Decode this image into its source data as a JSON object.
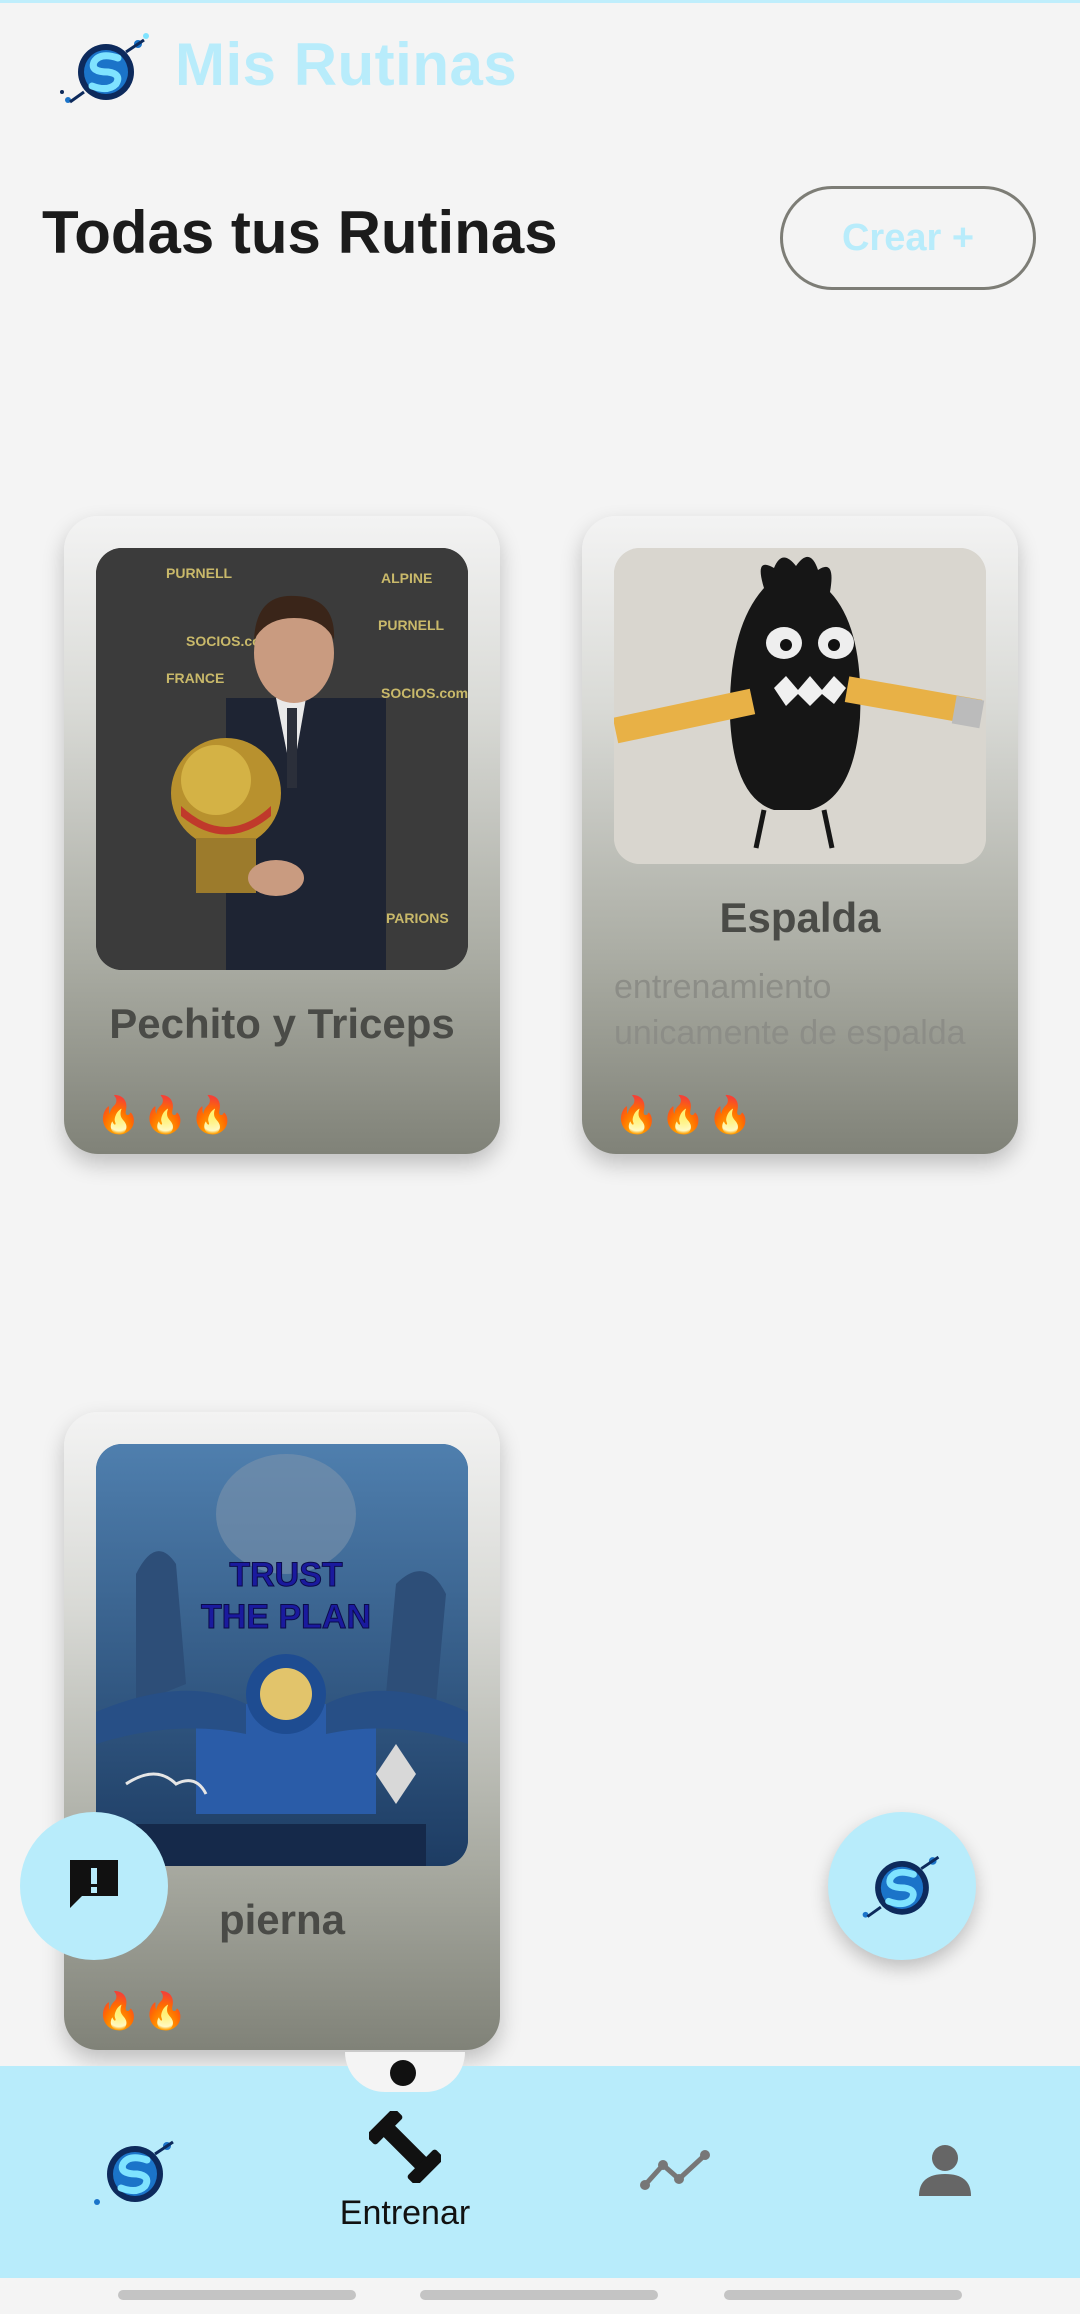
{
  "header": {
    "app_title": "Mis Rutinas",
    "logo_icon": "app-logo-icon"
  },
  "main": {
    "page_title": "Todas tus Rutinas",
    "create_label": "Crear +"
  },
  "routines": [
    {
      "title": "Pechito y Triceps",
      "description": "",
      "flames": "🔥🔥🔥"
    },
    {
      "title": "Espalda",
      "description": "entrenamiento unicamente de espalda",
      "flames": "🔥🔥🔥"
    },
    {
      "title": "pierna",
      "description": "",
      "flames": "🔥🔥"
    }
  ],
  "image_text": {
    "trust_the_plan": "TRUST THE PLAN"
  },
  "fab": {
    "feedback_icon": "feedback-icon",
    "logo_icon": "app-logo-icon"
  },
  "nav": {
    "active_label": "Entrenar",
    "items": [
      {
        "icon": "app-logo-icon"
      },
      {
        "icon": "dumbbell-icon",
        "label": "Entrenar"
      },
      {
        "icon": "trend-line-icon"
      },
      {
        "icon": "person-icon"
      }
    ]
  },
  "colors": {
    "accent": "#b8ecfb",
    "background": "#f4f4f4",
    "text_dark": "#1b1b1b"
  }
}
